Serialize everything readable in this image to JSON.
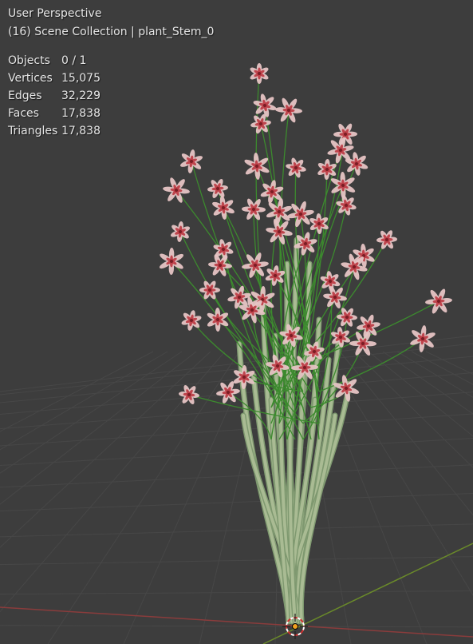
{
  "viewport": {
    "view_name": "User Perspective",
    "collection_info": "(16) Scene Collection | plant_Stem_0"
  },
  "stats": [
    {
      "label": "Objects",
      "value": "0 / 1"
    },
    {
      "label": "Vertices",
      "value": "15,075"
    },
    {
      "label": "Edges",
      "value": "32,229"
    },
    {
      "label": "Faces",
      "value": "17,838"
    },
    {
      "label": "Triangles",
      "value": "17,838"
    }
  ],
  "colors": {
    "background": "#3d3d3d",
    "grid": "#4a4a4a",
    "x_axis": "#8a3c3c",
    "y_axis": "#6a8a2a",
    "stem": "#a9bb93",
    "twig": "#3c8a2e",
    "petal": "#e6c4c4",
    "petal_center": "#b8303a",
    "origin": "#f0a020"
  },
  "icons": {
    "origin_marker": "object-origin-icon",
    "cursor": "3d-cursor-icon"
  }
}
